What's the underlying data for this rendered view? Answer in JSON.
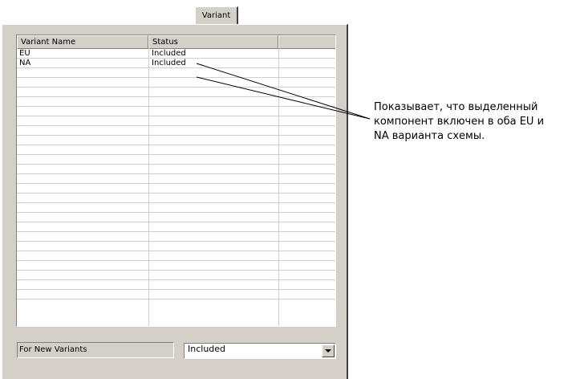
{
  "tab": {
    "label": "Variant"
  },
  "grid": {
    "columns": [
      "Variant Name",
      "Status",
      ""
    ],
    "rows": [
      {
        "name": "EU",
        "status": "Included"
      },
      {
        "name": "NA",
        "status": "Included"
      }
    ],
    "empty_row_count": 24
  },
  "footer": {
    "new_variants_label": "For New Variants",
    "new_variants_value": "Included"
  },
  "callout": {
    "text": "Показывает, что выделенный\nкомпонент включен в оба EU и\nNA варианта схемы."
  },
  "colors": {
    "panel": "#d4d0c8",
    "grid_line": "#d4d0c8",
    "shadow": "#808080"
  }
}
